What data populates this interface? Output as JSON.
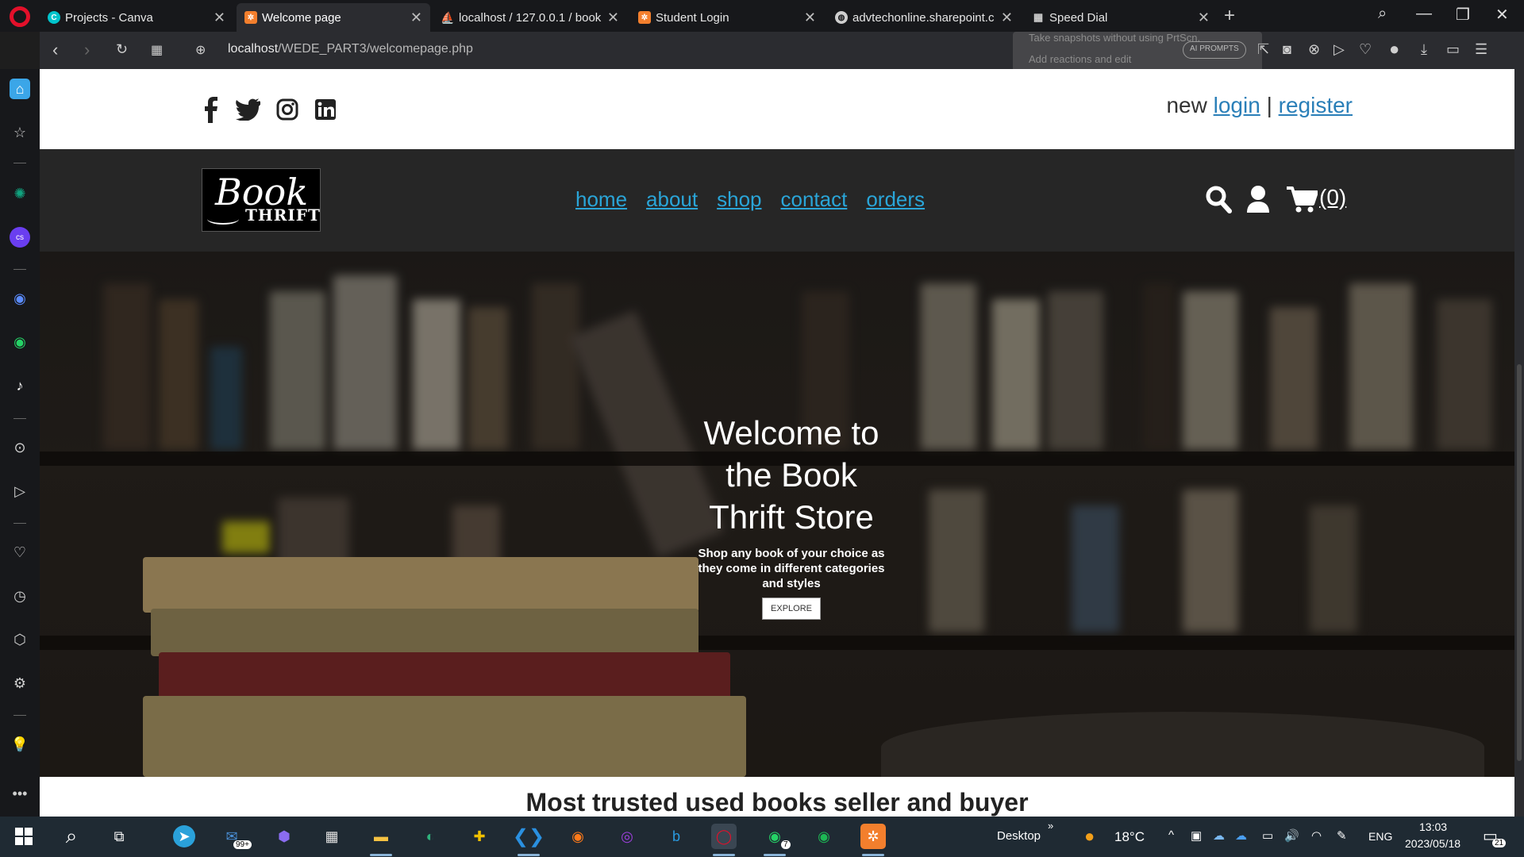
{
  "browser": {
    "tabs": [
      {
        "title": "Projects - Canva",
        "active": false,
        "icon": "canva-icon",
        "color": "#00c4cc"
      },
      {
        "title": "Welcome page",
        "active": true,
        "icon": "xampp-icon",
        "color": "#f37f2d"
      },
      {
        "title": "localhost / 127.0.0.1 / book",
        "active": false,
        "icon": "phpmyadmin-icon",
        "color": "#f0a000"
      },
      {
        "title": "Student Login",
        "active": false,
        "icon": "xampp-icon",
        "color": "#f37f2d"
      },
      {
        "title": "advtechonline.sharepoint.c",
        "active": false,
        "icon": "globe-icon",
        "color": "#cfcfcf"
      },
      {
        "title": "Speed Dial",
        "active": false,
        "icon": "speed-dial-icon",
        "color": "#cfcfcf"
      }
    ],
    "url_host": "localhost",
    "url_path": "/WEDE_PART3/welcomepage.php",
    "ai_prompts_label": "AI PROMPTS",
    "toast_line1": "Take snapshots without using PrtScn.",
    "toast_line2": "Add reactions and edit"
  },
  "page": {
    "auth": {
      "prefix": "new",
      "login": "login",
      "separator": "|",
      "register": "register"
    },
    "nav": [
      "home",
      "about",
      "shop",
      "contact",
      "orders"
    ],
    "cart_count": "(0)",
    "logo": {
      "line1": "Book",
      "line2": "THRIFT"
    },
    "hero": {
      "title": "Welcome to the Book Thrift Store",
      "subtitle": "Shop any book of your choice as they come in different categories and styles",
      "button": "EXPLORE"
    },
    "section_heading": "Most trusted used books seller and buyer"
  },
  "taskbar": {
    "mail_badge": "99+",
    "whatsapp_badge": "7",
    "desktop_label": "Desktop",
    "weather_temp": "18°C",
    "language": "ENG",
    "time": "13:03",
    "date": "2023/05/18",
    "notification_count": "21"
  },
  "colors": {
    "link": "#2aa5d8",
    "opera_red": "#e3102a",
    "header_bg": "#262626"
  }
}
